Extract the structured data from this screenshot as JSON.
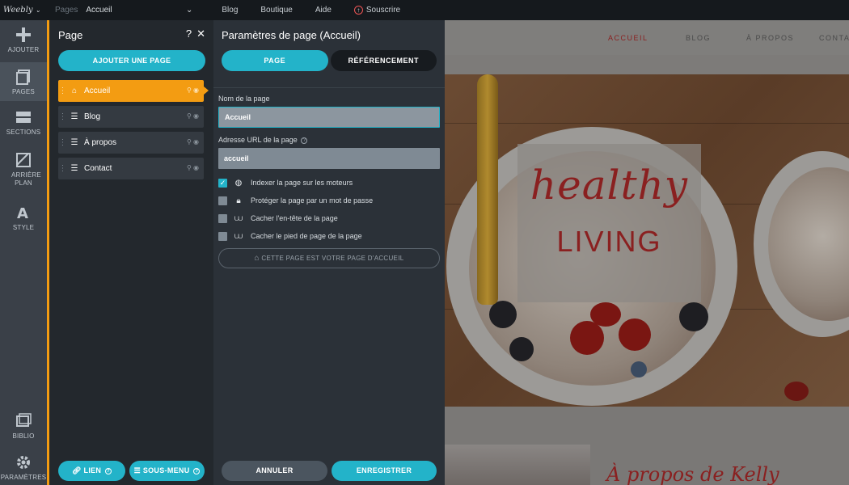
{
  "topbar": {
    "logo": "Weebly",
    "pages_label": "Pages",
    "current_page": "Accueil",
    "nav": [
      "Blog",
      "Boutique",
      "Aide"
    ],
    "subscribe": "Souscrire"
  },
  "rail": {
    "items": [
      {
        "label": "AJOUTER",
        "icon": "plus-icon"
      },
      {
        "label": "PAGES",
        "icon": "pages-icon"
      },
      {
        "label": "SECTIONS",
        "icon": "sections-icon"
      },
      {
        "label": "ARRIÈRE PLAN",
        "icon": "background-icon"
      },
      {
        "label": "STYLE",
        "icon": "style-icon"
      },
      {
        "label": "BIBLIO",
        "icon": "library-icon"
      },
      {
        "label": "PARAMÈTRES",
        "icon": "gear-icon"
      }
    ]
  },
  "page_panel": {
    "title": "Page",
    "help": "?",
    "close": "✕",
    "add_button": "AJOUTER UNE PAGE",
    "pages": [
      {
        "label": "Accueil",
        "icon": "home-icon",
        "active": true
      },
      {
        "label": "Blog",
        "icon": "page-icon",
        "active": false
      },
      {
        "label": "À propos",
        "icon": "page-icon",
        "active": false
      },
      {
        "label": "Contact",
        "icon": "page-icon",
        "active": false
      }
    ],
    "link_button": "LIEN",
    "submenu_button": "SOUS-MENU"
  },
  "settings": {
    "title": "Paramètres de page (Accueil)",
    "tab_page": "PAGE",
    "tab_seo": "RÉFÉRENCEMENT",
    "name_label": "Nom de la page",
    "name_value": "Accueil",
    "url_label": "Adresse URL de la page",
    "url_value": "accueil",
    "options": [
      {
        "label": "Indexer la page sur les moteurs",
        "checked": true,
        "icon": "globe-icon"
      },
      {
        "label": "Protéger la page par un mot de passe",
        "checked": false,
        "icon": "lock-icon"
      },
      {
        "label": "Cacher l'en-tête de la page",
        "checked": false,
        "icon": "eye-hide-icon"
      },
      {
        "label": "Cacher le pied de page de la page",
        "checked": false,
        "icon": "eye-hide-icon"
      }
    ],
    "home_button": "CETTE PAGE EST VOTRE PAGE D'ACCUEIL",
    "cancel": "ANNULER",
    "save": "ENREGISTRER"
  },
  "preview": {
    "nav": [
      "ACCUEIL",
      "BLOG",
      "À PROPOS",
      "CONTA"
    ],
    "hero_line1": "healthy",
    "hero_line2": "LIVING",
    "about_heading": "À propos de Kelly"
  },
  "colors": {
    "accent": "#23b3c9",
    "active_page": "#f39c12",
    "brand_red": "#8a2020"
  }
}
